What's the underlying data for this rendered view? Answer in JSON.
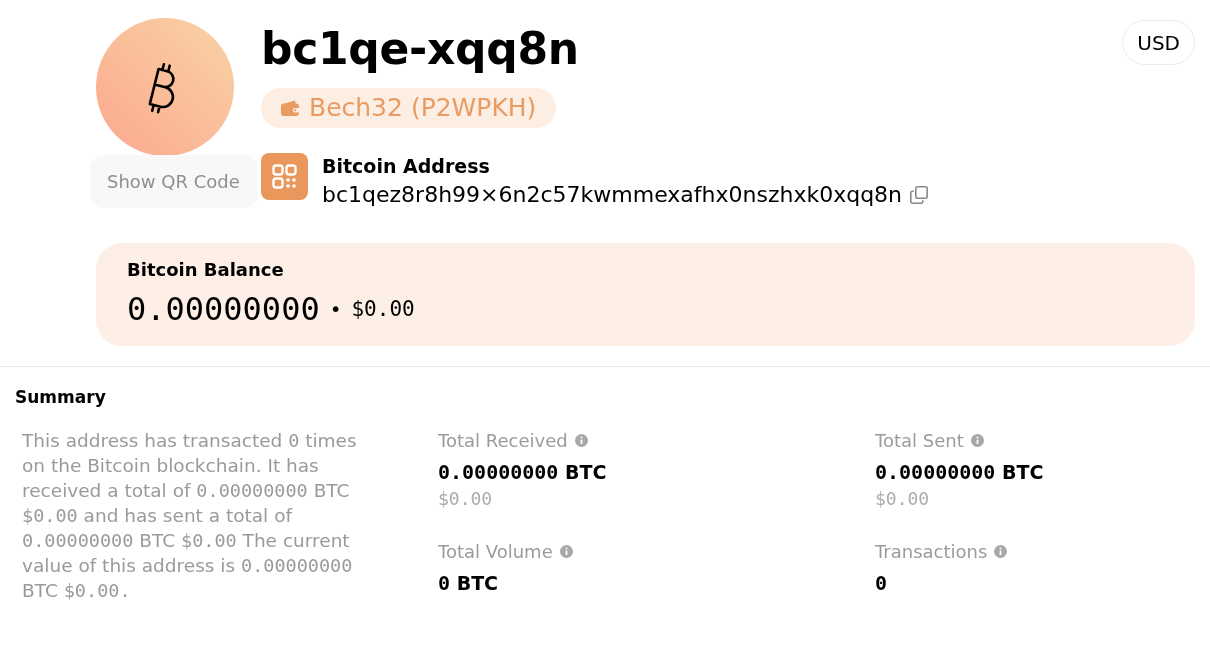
{
  "header": {
    "title": "bc1qe-xqq8n",
    "address_type": "Bech32 (P2WPKH)",
    "qr_button": "Show QR Code",
    "currency_button": "USD"
  },
  "address": {
    "label": "Bitcoin Address",
    "value": "bc1qez8r8h99×6n2c57kwmmexafhx0nszhxk0xqq8n"
  },
  "balance": {
    "label": "Bitcoin Balance",
    "amount": "0.00000000",
    "separator": "•",
    "fiat": "$0.00"
  },
  "summary": {
    "heading": "Summary",
    "segments": [
      {
        "kind": "text",
        "text": "This address has transacted"
      },
      {
        "kind": "figure",
        "text": "0"
      },
      {
        "kind": "text",
        "text": "times on the Bitcoin blockchain. It has received a total of"
      },
      {
        "kind": "figure",
        "text": "0.00000000"
      },
      {
        "kind": "text",
        "text": "BTC"
      },
      {
        "kind": "figure",
        "text": "$0.00"
      },
      {
        "kind": "text",
        "text": "and has sent a total of"
      },
      {
        "kind": "figure",
        "text": "0.00000000"
      },
      {
        "kind": "text",
        "text": "BTC"
      },
      {
        "kind": "figure",
        "text": "$0.00"
      },
      {
        "kind": "text",
        "text": "The current value of this address is"
      },
      {
        "kind": "figure",
        "text": "0.00000000"
      },
      {
        "kind": "text",
        "text": "BTC"
      },
      {
        "kind": "figure",
        "text": "$0.00."
      }
    ],
    "stats": [
      {
        "label": "Total Received",
        "amount": "0.00000000",
        "unit": "BTC",
        "fiat": "$0.00"
      },
      {
        "label": "Total Sent",
        "amount": "0.00000000",
        "unit": "BTC",
        "fiat": "$0.00"
      },
      {
        "label": "Total Volume",
        "amount": "0",
        "unit": "BTC"
      },
      {
        "label": "Transactions",
        "amount": "0"
      }
    ]
  }
}
